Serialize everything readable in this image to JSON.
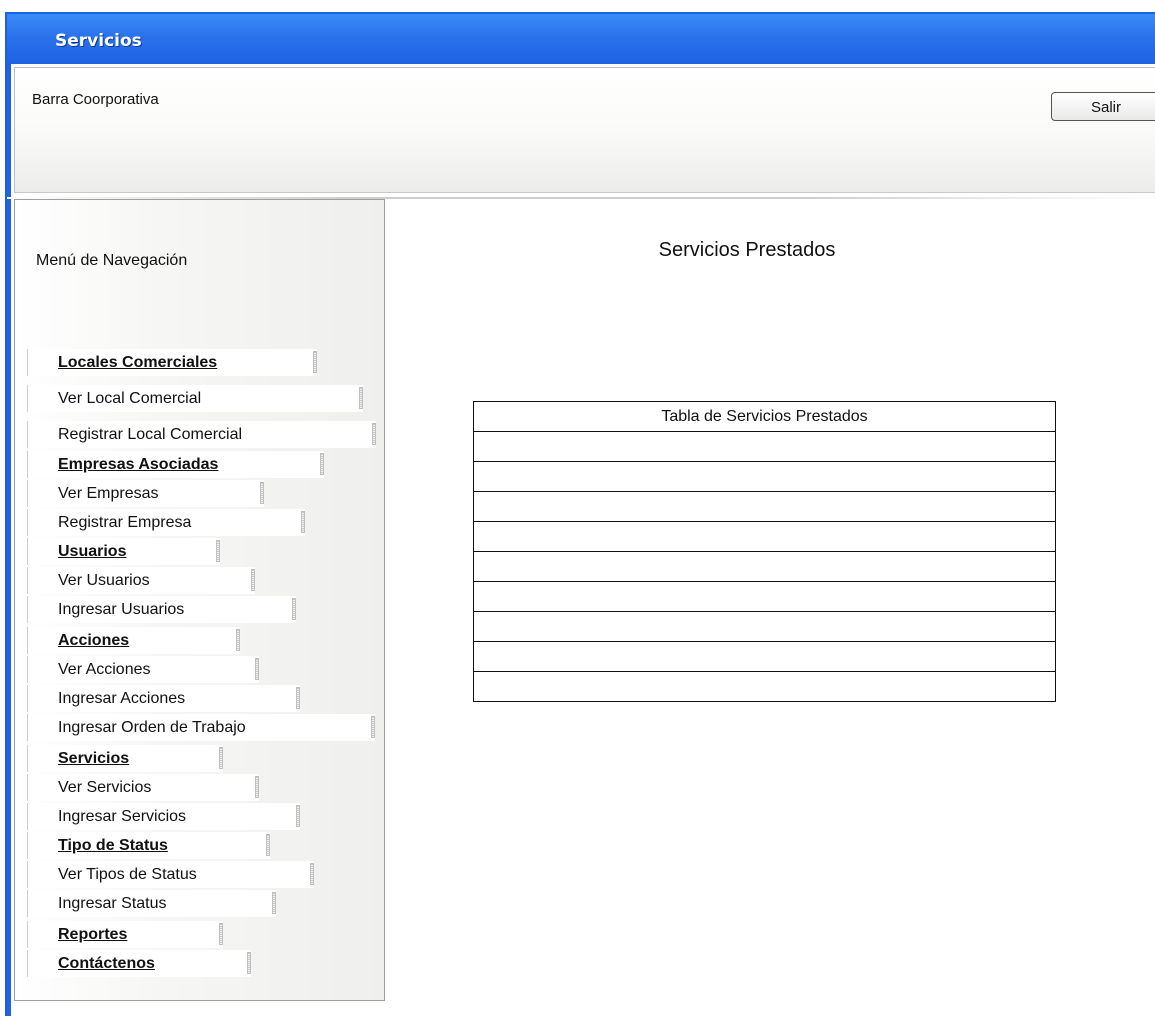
{
  "window": {
    "title": "Servicios"
  },
  "header": {
    "corp_label": "Barra Coorporativa",
    "logout_label": "Salir"
  },
  "sidebar": {
    "title": "Menú de Navegación",
    "items": [
      {
        "label": "Locales Comerciales",
        "type": "header"
      },
      {
        "label": "Ver Local Comercial",
        "type": "link"
      },
      {
        "label": "Registrar Local Comercial",
        "type": "link"
      },
      {
        "label": "Empresas Asociadas",
        "type": "header"
      },
      {
        "label": "Ver Empresas",
        "type": "link"
      },
      {
        "label": "Registrar Empresa",
        "type": "link"
      },
      {
        "label": "Usuarios",
        "type": "header"
      },
      {
        "label": "Ver Usuarios",
        "type": "link"
      },
      {
        "label": "Ingresar Usuarios",
        "type": "link"
      },
      {
        "label": "Acciones",
        "type": "header"
      },
      {
        "label": "Ver Acciones",
        "type": "link"
      },
      {
        "label": "Ingresar Acciones",
        "type": "link"
      },
      {
        "label": "Ingresar Orden de Trabajo",
        "type": "link"
      },
      {
        "label": "Servicios",
        "type": "header"
      },
      {
        "label": "Ver Servicios",
        "type": "link"
      },
      {
        "label": "Ingresar Servicios",
        "type": "link"
      },
      {
        "label": "Tipo de Status",
        "type": "header"
      },
      {
        "label": "Ver Tipos de Status",
        "type": "link"
      },
      {
        "label": "Ingresar Status",
        "type": "link"
      },
      {
        "label": "Reportes",
        "type": "header"
      },
      {
        "label": "Contáctenos",
        "type": "header"
      }
    ]
  },
  "main": {
    "title": "Servicios Prestados",
    "table": {
      "header": "Tabla de Servicios Prestados",
      "rows": [
        "",
        "",
        "",
        "",
        "",
        "",
        "",
        "",
        ""
      ]
    }
  },
  "colors": {
    "titlebar": "#2a72ec",
    "frame": "#1e63e2"
  }
}
